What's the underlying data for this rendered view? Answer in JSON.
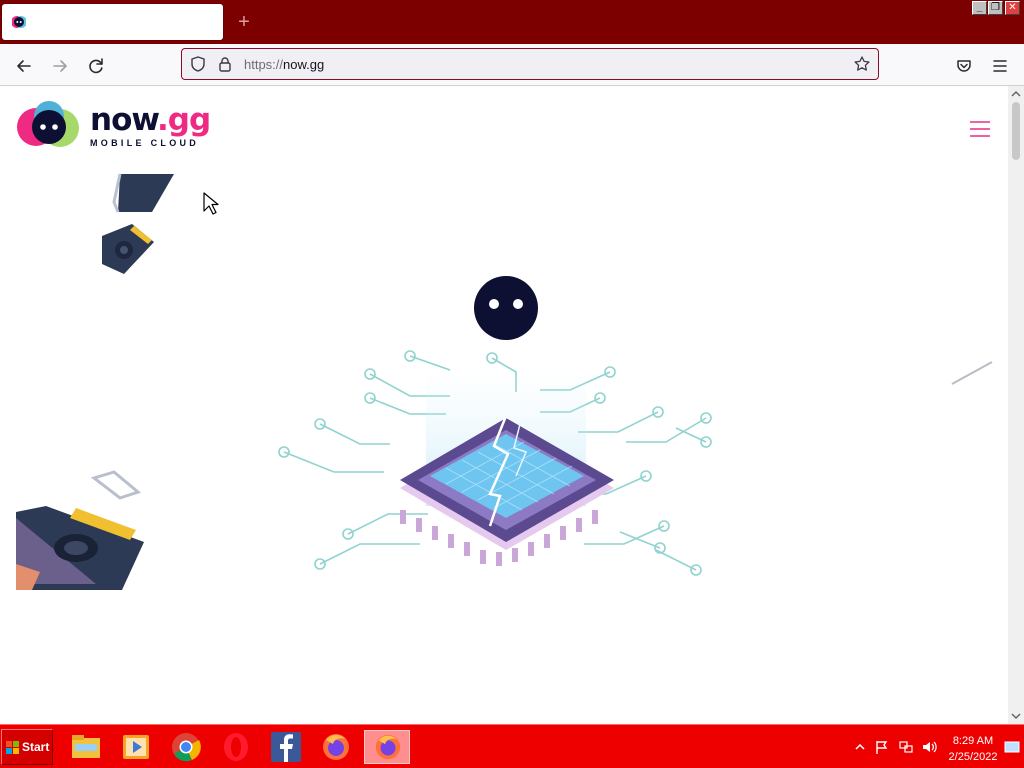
{
  "browser": {
    "tab": {
      "title": "",
      "favicon": "nowgg-face-icon"
    },
    "new_tab_glyph": "+",
    "window_controls": {
      "minimize": "_",
      "restore": "❐",
      "close": "✕"
    },
    "url": {
      "scheme": "https://",
      "host": "now.gg"
    },
    "icons": [
      "back-arrow-icon",
      "forward-arrow-icon",
      "reload-icon",
      "shield-icon",
      "lock-icon",
      "star-icon",
      "pocket-icon",
      "hamburger-menu-icon"
    ]
  },
  "page": {
    "logo": {
      "brand_main": "now",
      "brand_dot": ".gg",
      "tagline": "MOBILE CLOUD"
    }
  },
  "taskbar": {
    "start_label": "Start",
    "apps": [
      "file-explorer-icon",
      "media-player-icon",
      "chrome-icon",
      "opera-icon",
      "facebook-icon",
      "firefox-icon",
      "firefox-active-icon"
    ],
    "clock": {
      "time": "8:29 AM",
      "date": "2/25/2022"
    }
  },
  "colors": {
    "tabbar": "#7d0000",
    "taskbar": "#ee0000",
    "accent_pink": "#ee2a83",
    "brand_navy": "#0d1033"
  }
}
